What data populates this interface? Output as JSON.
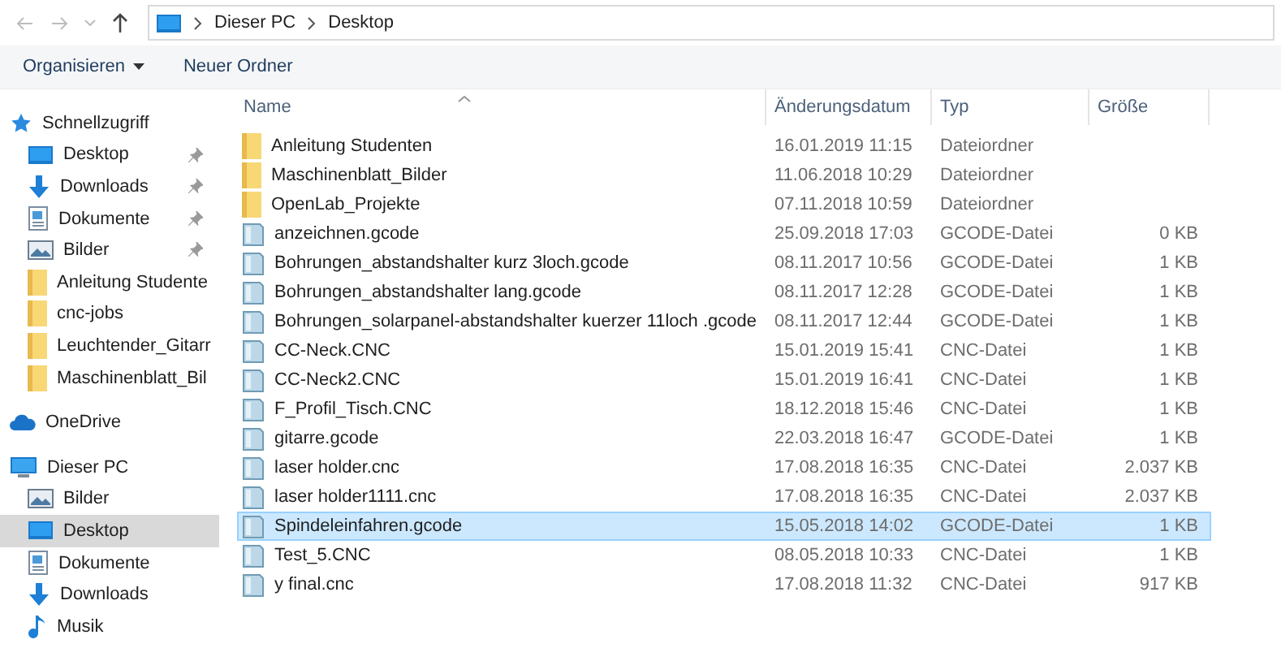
{
  "address_bar": {
    "path": [
      "Dieser PC",
      "Desktop"
    ]
  },
  "toolbar": {
    "buttons": [
      {
        "label": "Organisieren",
        "kind": "dropdown"
      },
      {
        "label": "Neuer Ordner",
        "kind": "plain"
      }
    ]
  },
  "sidebar": {
    "items": [
      {
        "label": "Schnellzugriff",
        "kind": "star",
        "selected": false,
        "children": [
          {
            "label": "Desktop",
            "kind": "desktop",
            "pinned": true,
            "selected": false
          },
          {
            "label": "Downloads",
            "kind": "download",
            "pinned": true,
            "selected": false
          },
          {
            "label": "Dokumente",
            "kind": "document",
            "pinned": true,
            "selected": false
          },
          {
            "label": "Bilder",
            "kind": "pictures",
            "pinned": true,
            "selected": false
          },
          {
            "label": "Anleitung Studente",
            "kind": "folder",
            "pinned": false,
            "selected": false
          },
          {
            "label": "cnc-jobs",
            "kind": "folder",
            "pinned": false,
            "selected": false
          },
          {
            "label": "Leuchtender_Gitarr",
            "kind": "folder",
            "pinned": false,
            "selected": false
          },
          {
            "label": "Maschinenblatt_Bil",
            "kind": "folder",
            "pinned": false,
            "selected": false
          }
        ]
      },
      {
        "label": "OneDrive",
        "kind": "cloud",
        "selected": false
      },
      {
        "label": "Dieser PC",
        "kind": "pc",
        "selected": false,
        "children": [
          {
            "label": "Bilder",
            "kind": "pictures",
            "pinned": false,
            "selected": false
          },
          {
            "label": "Desktop",
            "kind": "desktop",
            "pinned": false,
            "selected": true
          },
          {
            "label": "Dokumente",
            "kind": "document",
            "pinned": false,
            "selected": false
          },
          {
            "label": "Downloads",
            "kind": "download",
            "pinned": false,
            "selected": false
          },
          {
            "label": "Musik",
            "kind": "music",
            "pinned": false,
            "selected": false
          }
        ]
      }
    ]
  },
  "table": {
    "columns": [
      "Name",
      "Änderungsdatum",
      "Typ",
      "Größe"
    ],
    "rows": [
      {
        "name": "Anleitung Studenten",
        "date": "16.01.2019 11:15",
        "type": "Dateiordner",
        "size": "",
        "kind": "folder",
        "selected": false
      },
      {
        "name": "Maschinenblatt_Bilder",
        "date": "11.06.2018 10:29",
        "type": "Dateiordner",
        "size": "",
        "kind": "folder",
        "selected": false
      },
      {
        "name": "OpenLab_Projekte",
        "date": "07.11.2018 10:59",
        "type": "Dateiordner",
        "size": "",
        "kind": "folder",
        "selected": false
      },
      {
        "name": "anzeichnen.gcode",
        "date": "25.09.2018 17:03",
        "type": "GCODE-Datei",
        "size": "0 KB",
        "kind": "file",
        "selected": false
      },
      {
        "name": "Bohrungen_abstandshalter kurz 3loch.gcode",
        "date": "08.11.2017 10:56",
        "type": "GCODE-Datei",
        "size": "1 KB",
        "kind": "file",
        "selected": false
      },
      {
        "name": "Bohrungen_abstandshalter lang.gcode",
        "date": "08.11.2017 12:28",
        "type": "GCODE-Datei",
        "size": "1 KB",
        "kind": "file",
        "selected": false
      },
      {
        "name": "Bohrungen_solarpanel-abstandshalter kuerzer 11loch .gcode",
        "date": "08.11.2017 12:44",
        "type": "GCODE-Datei",
        "size": "1 KB",
        "kind": "file",
        "selected": false
      },
      {
        "name": "CC-Neck.CNC",
        "date": "15.01.2019 15:41",
        "type": "CNC-Datei",
        "size": "1 KB",
        "kind": "file",
        "selected": false
      },
      {
        "name": "CC-Neck2.CNC",
        "date": "15.01.2019 16:41",
        "type": "CNC-Datei",
        "size": "1 KB",
        "kind": "file",
        "selected": false
      },
      {
        "name": "F_Profil_Tisch.CNC",
        "date": "18.12.2018 15:46",
        "type": "CNC-Datei",
        "size": "1 KB",
        "kind": "file",
        "selected": false
      },
      {
        "name": "gitarre.gcode",
        "date": "22.03.2018 16:47",
        "type": "GCODE-Datei",
        "size": "1 KB",
        "kind": "file",
        "selected": false
      },
      {
        "name": "laser holder.cnc",
        "date": "17.08.2018 16:35",
        "type": "CNC-Datei",
        "size": "2.037 KB",
        "kind": "file",
        "selected": false
      },
      {
        "name": "laser holder1111.cnc",
        "date": "17.08.2018 16:35",
        "type": "CNC-Datei",
        "size": "2.037 KB",
        "kind": "file",
        "selected": false
      },
      {
        "name": "Spindeleinfahren.gcode",
        "date": "15.05.2018 14:02",
        "type": "GCODE-Datei",
        "size": "1 KB",
        "kind": "file",
        "selected": true
      },
      {
        "name": "Test_5.CNC",
        "date": "08.05.2018 10:33",
        "type": "CNC-Datei",
        "size": "1 KB",
        "kind": "file",
        "selected": false
      },
      {
        "name": "y final.cnc",
        "date": "17.08.2018 11:32",
        "type": "CNC-Datei",
        "size": "917 KB",
        "kind": "file",
        "selected": false
      }
    ]
  }
}
